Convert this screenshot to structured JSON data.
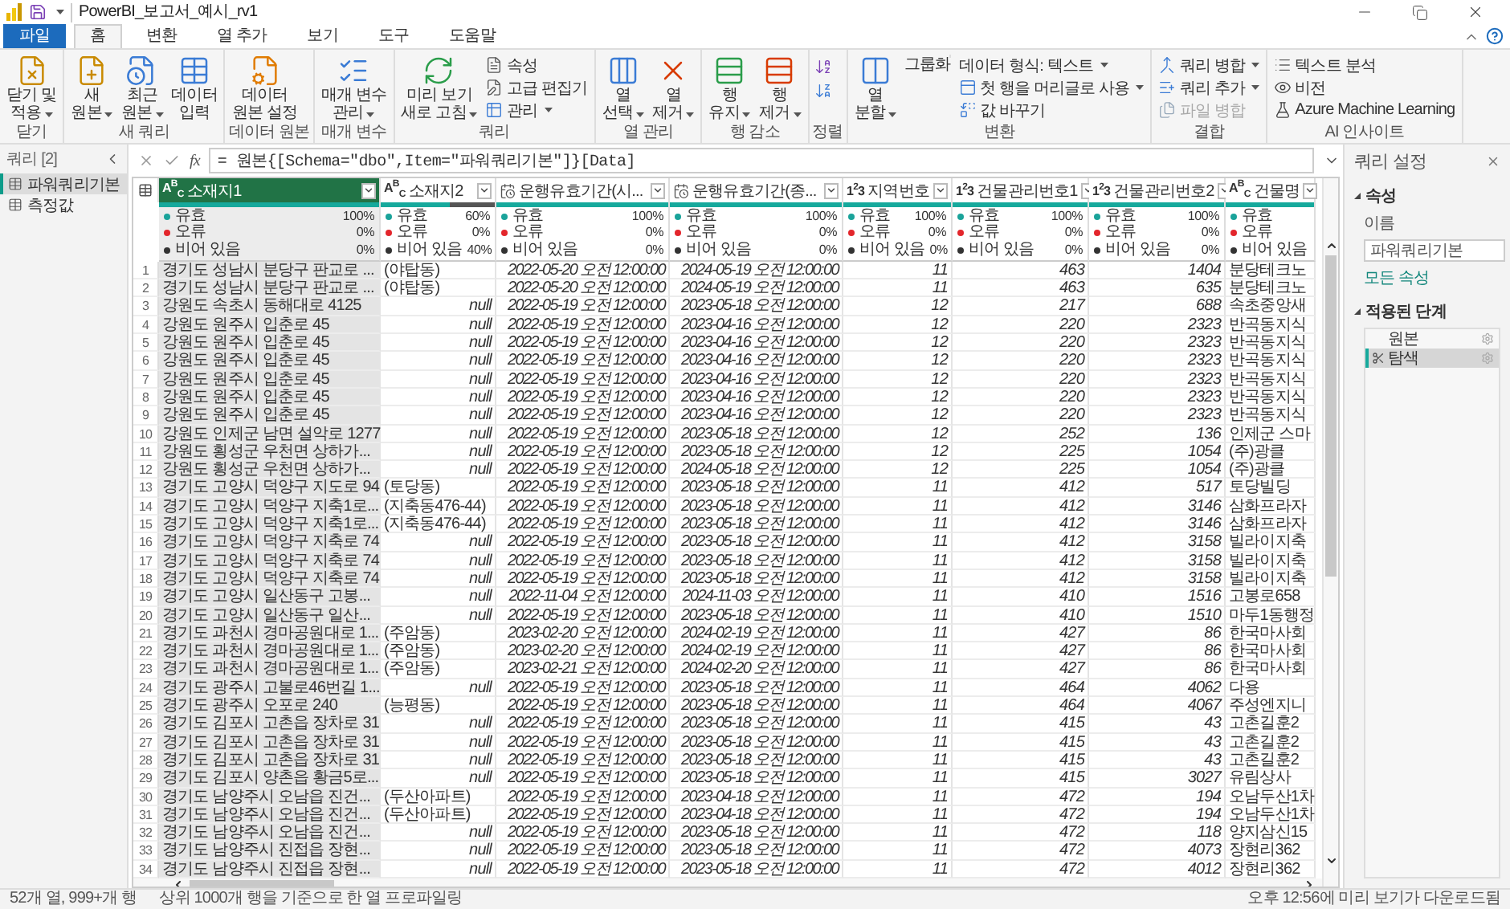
{
  "window": {
    "title": "PowerBI_보고서_예시_rv1"
  },
  "tabs": [
    {
      "label": "파일",
      "kind": "menu",
      "selected": false
    },
    {
      "label": "홈",
      "kind": "tab",
      "selected": true
    },
    {
      "label": "변환",
      "kind": "tab",
      "selected": false
    },
    {
      "label": "열 추가",
      "kind": "tab",
      "selected": false
    },
    {
      "label": "보기",
      "kind": "tab",
      "selected": false
    },
    {
      "label": "도구",
      "kind": "tab",
      "selected": false
    },
    {
      "label": "도움말",
      "kind": "tab",
      "selected": false
    }
  ],
  "ribbon": {
    "groups": [
      {
        "label": "닫기",
        "items": [
          {
            "kind": "large",
            "lines": [
              "닫기 및",
              "적용"
            ],
            "dropdown": true
          }
        ]
      },
      {
        "label": "새 쿼리",
        "items": [
          {
            "kind": "large",
            "lines": [
              "새",
              "원본"
            ],
            "dropdown": true
          },
          {
            "kind": "large",
            "lines": [
              "최근",
              "원본"
            ],
            "dropdown": true
          },
          {
            "kind": "large",
            "lines": [
              "데이터",
              "입력"
            ],
            "dropdown": false
          }
        ]
      },
      {
        "label": "데이터 원본",
        "items": [
          {
            "kind": "large",
            "lines": [
              "데이터",
              "원본 설정"
            ],
            "dropdown": false
          }
        ]
      },
      {
        "label": "매개 변수",
        "items": [
          {
            "kind": "large",
            "lines": [
              "매개 변수",
              "관리"
            ],
            "dropdown": true
          }
        ]
      },
      {
        "label": "쿼리",
        "items": [
          {
            "kind": "large",
            "lines": [
              "미리 보기",
              "새로 고침"
            ],
            "dropdown": true
          },
          {
            "kind": "stack",
            "items": [
              {
                "label": "속성",
                "dropdown": false,
                "disabled": false
              },
              {
                "label": "고급 편집기",
                "dropdown": false,
                "disabled": false
              },
              {
                "label": "관리",
                "dropdown": true,
                "disabled": false
              }
            ]
          }
        ]
      },
      {
        "label": "열 관리",
        "items": [
          {
            "kind": "large",
            "lines": [
              "열",
              "선택"
            ],
            "dropdown": true
          },
          {
            "kind": "large",
            "lines": [
              "열",
              "제거"
            ],
            "dropdown": true
          }
        ]
      },
      {
        "label": "행 감소",
        "items": [
          {
            "kind": "large",
            "lines": [
              "행",
              "유지"
            ],
            "dropdown": true
          },
          {
            "kind": "large",
            "lines": [
              "행",
              "제거"
            ],
            "dropdown": true
          }
        ]
      },
      {
        "label": "정렬",
        "items": [
          {
            "kind": "stack",
            "items": [
              {
                "disabled": false
              },
              {
                "disabled": false
              }
            ]
          }
        ]
      },
      {
        "label": "변환",
        "items": [
          {
            "kind": "large",
            "lines": [
              "열",
              "분할"
            ],
            "dropdown": true
          },
          {
            "kind": "large",
            "lines": [
              "그룹화"
            ],
            "dropdown": false
          },
          {
            "kind": "stack",
            "items": [
              {
                "label": "데이터 형식: 텍스트",
                "dropdown": true,
                "disabled": false
              },
              {
                "label": "첫 행을 머리글로 사용",
                "dropdown": true,
                "disabled": false
              },
              {
                "label": "값 바꾸기",
                "dropdown": false,
                "disabled": false
              }
            ]
          }
        ]
      },
      {
        "label": "결합",
        "items": [
          {
            "kind": "stack",
            "items": [
              {
                "label": "쿼리 병합",
                "dropdown": true,
                "disabled": false
              },
              {
                "label": "쿼리 추가",
                "dropdown": true,
                "disabled": false
              },
              {
                "label": "파일 병합",
                "dropdown": false,
                "disabled": true
              }
            ]
          }
        ]
      },
      {
        "label": "AI 인사이트",
        "items": [
          {
            "kind": "stack",
            "items": [
              {
                "label": "텍스트 분석",
                "dropdown": false,
                "disabled": false
              },
              {
                "label": "비전",
                "dropdown": false,
                "disabled": false
              },
              {
                "label": "Azure Machine Learning",
                "dropdown": false,
                "disabled": false
              }
            ]
          }
        ]
      }
    ]
  },
  "queries": {
    "title": "쿼리 [2]",
    "items": [
      {
        "label": "파워쿼리기본",
        "selected": true
      },
      {
        "label": "측정값",
        "selected": false
      }
    ]
  },
  "formula": {
    "fx_label": "fx",
    "text": "= 원본{[Schema=\"dbo\",Item=\"파워쿼리기본\"]}[Data]"
  },
  "table": {
    "columns": [
      {
        "kind": "text",
        "type_label": "A$^{B}$$_{C}$",
        "name": "소재지1",
        "selected": true,
        "level": 1,
        "stats": [
          {
            "label": "유효",
            "value": "100%",
            "color": "#1aa39a"
          },
          {
            "label": "오류",
            "value": "0%",
            "color": "#e3262c"
          },
          {
            "label": "비어 있음",
            "value": "0%",
            "color": "#333333"
          }
        ]
      },
      {
        "kind": "text",
        "type_label": "A$^{B}$$_{C}$",
        "name": "소재지2",
        "selected": false,
        "level": 0.6,
        "stats": [
          {
            "label": "유효",
            "value": "60%",
            "color": "#1aa39a"
          },
          {
            "label": "오류",
            "value": "0%",
            "color": "#e3262c"
          },
          {
            "label": "비어 있음",
            "value": "40%",
            "color": "#333333"
          }
        ]
      },
      {
        "kind": "datetime",
        "name": "운행유효기간(시...",
        "selected": false,
        "level": 1,
        "stats": [
          {
            "label": "유효",
            "value": "100%",
            "color": "#1aa39a"
          },
          {
            "label": "오류",
            "value": "0%",
            "color": "#e3262c"
          },
          {
            "label": "비어 있음",
            "value": "0%",
            "color": "#333333"
          }
        ]
      },
      {
        "kind": "datetime",
        "name": "운행유효기간(종...",
        "selected": false,
        "level": 1,
        "stats": [
          {
            "label": "유효",
            "value": "100%",
            "color": "#1aa39a"
          },
          {
            "label": "오류",
            "value": "0%",
            "color": "#e3262c"
          },
          {
            "label": "비어 있음",
            "value": "0%",
            "color": "#333333"
          }
        ]
      },
      {
        "kind": "number",
        "type_label": "1$^{2}$3",
        "name": "지역번호",
        "selected": false,
        "level": 1,
        "stats": [
          {
            "label": "유효",
            "value": "100%",
            "color": "#1aa39a"
          },
          {
            "label": "오류",
            "value": "0%",
            "color": "#e3262c"
          },
          {
            "label": "비어 있음",
            "value": "0%",
            "color": "#333333"
          }
        ]
      },
      {
        "kind": "number",
        "type_label": "1$^{2}$3",
        "name": "건물관리번호1",
        "selected": false,
        "level": 1,
        "stats": [
          {
            "label": "유효",
            "value": "100%",
            "color": "#1aa39a"
          },
          {
            "label": "오류",
            "value": "0%",
            "color": "#e3262c"
          },
          {
            "label": "비어 있음",
            "value": "0%",
            "color": "#333333"
          }
        ]
      },
      {
        "kind": "number",
        "type_label": "1$^{2}$3",
        "name": "건물관리번호2",
        "selected": false,
        "level": 1,
        "stats": [
          {
            "label": "유효",
            "value": "100%",
            "color": "#1aa39a"
          },
          {
            "label": "오류",
            "value": "0%",
            "color": "#e3262c"
          },
          {
            "label": "비어 있음",
            "value": "0%",
            "color": "#333333"
          }
        ]
      },
      {
        "kind": "text",
        "type_label": "A$^{B}$$_{C}$",
        "name": "건물명",
        "selected": false,
        "level": 1,
        "stats": [
          {
            "label": "유효",
            "color": "#1aa39a"
          },
          {
            "label": "오류",
            "color": "#e3262c"
          },
          {
            "label": "비어 있음",
            "color": "#333333"
          }
        ]
      }
    ],
    "rows": [
      {
        "number": "1",
        "location2_null": false,
        "cells": [
          "경기도 성남시 분당구 판교로 ...",
          "(야탑동)",
          "2022-05-20 오전 12:00:00",
          "2024-05-19 오전 12:00:00",
          "11",
          "463",
          "1404",
          "분당테크노"
        ]
      },
      {
        "number": "2",
        "location2_null": false,
        "cells": [
          "경기도 성남시 분당구 판교로 ...",
          "(야탑동)",
          "2022-05-20 오전 12:00:00",
          "2024-05-19 오전 12:00:00",
          "11",
          "463",
          "635",
          "분당테크노"
        ]
      },
      {
        "number": "3",
        "location2_null": true,
        "cells": [
          "강원도 속초시 동해대로 4125",
          "null",
          "2022-05-19 오전 12:00:00",
          "2023-05-18 오전 12:00:00",
          "12",
          "217",
          "688",
          "속초중앙새"
        ]
      },
      {
        "number": "4",
        "location2_null": true,
        "cells": [
          "강원도 원주시 입춘로 45",
          "null",
          "2022-05-19 오전 12:00:00",
          "2023-04-16 오전 12:00:00",
          "12",
          "220",
          "2323",
          "반곡동지식"
        ]
      },
      {
        "number": "5",
        "location2_null": true,
        "cells": [
          "강원도 원주시 입춘로 45",
          "null",
          "2022-05-19 오전 12:00:00",
          "2023-04-16 오전 12:00:00",
          "12",
          "220",
          "2323",
          "반곡동지식"
        ]
      },
      {
        "number": "6",
        "location2_null": true,
        "cells": [
          "강원도 원주시 입춘로 45",
          "null",
          "2022-05-19 오전 12:00:00",
          "2023-04-16 오전 12:00:00",
          "12",
          "220",
          "2323",
          "반곡동지식"
        ]
      },
      {
        "number": "7",
        "location2_null": true,
        "cells": [
          "강원도 원주시 입춘로 45",
          "null",
          "2022-05-19 오전 12:00:00",
          "2023-04-16 오전 12:00:00",
          "12",
          "220",
          "2323",
          "반곡동지식"
        ]
      },
      {
        "number": "8",
        "location2_null": true,
        "cells": [
          "강원도 원주시 입춘로 45",
          "null",
          "2022-05-19 오전 12:00:00",
          "2023-04-16 오전 12:00:00",
          "12",
          "220",
          "2323",
          "반곡동지식"
        ]
      },
      {
        "number": "9",
        "location2_null": true,
        "cells": [
          "강원도 원주시 입춘로 45",
          "null",
          "2022-05-19 오전 12:00:00",
          "2023-04-16 오전 12:00:00",
          "12",
          "220",
          "2323",
          "반곡동지식"
        ]
      },
      {
        "number": "10",
        "location2_null": true,
        "cells": [
          "강원도 인제군 남면 설악로 1277",
          "null",
          "2022-05-19 오전 12:00:00",
          "2023-05-18 오전 12:00:00",
          "12",
          "252",
          "136",
          "인제군 스마"
        ]
      },
      {
        "number": "11",
        "location2_null": true,
        "cells": [
          "강원도 횡성군 우천면 상하가...",
          "null",
          "2022-05-19 오전 12:00:00",
          "2023-05-18 오전 12:00:00",
          "12",
          "225",
          "1054",
          "(주)광클"
        ]
      },
      {
        "number": "12",
        "location2_null": true,
        "cells": [
          "강원도 횡성군 우천면 상하가...",
          "null",
          "2022-05-19 오전 12:00:00",
          "2024-05-18 오전 12:00:00",
          "12",
          "225",
          "1054",
          "(주)광클"
        ]
      },
      {
        "number": "13",
        "location2_null": false,
        "cells": [
          "경기도 고양시 덕양구 지도로 94",
          "(토당동)",
          "2022-05-19 오전 12:00:00",
          "2023-05-18 오전 12:00:00",
          "11",
          "412",
          "517",
          "토당빌딩"
        ]
      },
      {
        "number": "14",
        "location2_null": false,
        "cells": [
          "경기도 고양시 덕양구 지축1로...",
          "(지축동476-44)",
          "2022-05-19 오전 12:00:00",
          "2023-05-18 오전 12:00:00",
          "11",
          "412",
          "3146",
          "삼화프라자"
        ]
      },
      {
        "number": "15",
        "location2_null": false,
        "cells": [
          "경기도 고양시 덕양구 지축1로...",
          "(지축동476-44)",
          "2022-05-19 오전 12:00:00",
          "2023-05-18 오전 12:00:00",
          "11",
          "412",
          "3146",
          "삼화프라자"
        ]
      },
      {
        "number": "16",
        "location2_null": true,
        "cells": [
          "경기도 고양시 덕양구 지축로 74",
          "null",
          "2022-05-19 오전 12:00:00",
          "2023-05-18 오전 12:00:00",
          "11",
          "412",
          "3158",
          "빌라이지축"
        ]
      },
      {
        "number": "17",
        "location2_null": true,
        "cells": [
          "경기도 고양시 덕양구 지축로 74",
          "null",
          "2022-05-19 오전 12:00:00",
          "2023-05-18 오전 12:00:00",
          "11",
          "412",
          "3158",
          "빌라이지축"
        ]
      },
      {
        "number": "18",
        "location2_null": true,
        "cells": [
          "경기도 고양시 덕양구 지축로 74",
          "null",
          "2022-05-19 오전 12:00:00",
          "2023-05-18 오전 12:00:00",
          "11",
          "412",
          "3158",
          "빌라이지축"
        ]
      },
      {
        "number": "19",
        "location2_null": true,
        "cells": [
          "경기도 고양시 일산동구 고봉...",
          "null",
          "2022-11-04 오전 12:00:00",
          "2024-11-03 오전 12:00:00",
          "11",
          "410",
          "1516",
          "고봉로658"
        ]
      },
      {
        "number": "20",
        "location2_null": true,
        "cells": [
          "경기도 고양시 일산동구 일산...",
          "null",
          "2022-05-19 오전 12:00:00",
          "2023-05-18 오전 12:00:00",
          "11",
          "410",
          "1510",
          "마두1동행정"
        ]
      },
      {
        "number": "21",
        "location2_null": false,
        "cells": [
          "경기도 과천시 경마공원대로 1...",
          "(주암동)",
          "2023-02-20 오전 12:00:00",
          "2024-02-19 오전 12:00:00",
          "11",
          "427",
          "86",
          "한국마사회"
        ]
      },
      {
        "number": "22",
        "location2_null": false,
        "cells": [
          "경기도 과천시 경마공원대로 1...",
          "(주암동)",
          "2023-02-20 오전 12:00:00",
          "2024-02-19 오전 12:00:00",
          "11",
          "427",
          "86",
          "한국마사회"
        ]
      },
      {
        "number": "23",
        "location2_null": false,
        "cells": [
          "경기도 과천시 경마공원대로 1...",
          "(주암동)",
          "2023-02-21 오전 12:00:00",
          "2024-02-20 오전 12:00:00",
          "11",
          "427",
          "86",
          "한국마사회"
        ]
      },
      {
        "number": "24",
        "location2_null": true,
        "cells": [
          "경기도 광주시 고불로46번길 1...",
          "null",
          "2022-05-19 오전 12:00:00",
          "2023-05-18 오전 12:00:00",
          "11",
          "464",
          "4062",
          "다용"
        ]
      },
      {
        "number": "25",
        "location2_null": false,
        "cells": [
          "경기도 광주시 오포로 240",
          "(능평동)",
          "2022-05-19 오전 12:00:00",
          "2023-05-18 오전 12:00:00",
          "11",
          "464",
          "4067",
          "주성엔지니"
        ]
      },
      {
        "number": "26",
        "location2_null": true,
        "cells": [
          "경기도 김포시 고촌읍 장차로 31",
          "null",
          "2022-05-19 오전 12:00:00",
          "2023-05-18 오전 12:00:00",
          "11",
          "415",
          "43",
          "고촌길훈2"
        ]
      },
      {
        "number": "27",
        "location2_null": true,
        "cells": [
          "경기도 김포시 고촌읍 장차로 31",
          "null",
          "2022-05-19 오전 12:00:00",
          "2023-05-18 오전 12:00:00",
          "11",
          "415",
          "43",
          "고촌길훈2"
        ]
      },
      {
        "number": "28",
        "location2_null": true,
        "cells": [
          "경기도 김포시 고촌읍 장차로 31",
          "null",
          "2022-05-19 오전 12:00:00",
          "2023-05-18 오전 12:00:00",
          "11",
          "415",
          "43",
          "고촌길훈2"
        ]
      },
      {
        "number": "29",
        "location2_null": true,
        "cells": [
          "경기도 김포시 양촌읍 황금5로...",
          "null",
          "2022-05-19 오전 12:00:00",
          "2023-05-18 오전 12:00:00",
          "11",
          "415",
          "3027",
          "유림상사"
        ]
      },
      {
        "number": "30",
        "location2_null": false,
        "cells": [
          "경기도 남양주시 오남읍 진건...",
          "(두산아파트)",
          "2022-05-19 오전 12:00:00",
          "2023-04-18 오전 12:00:00",
          "11",
          "472",
          "194",
          "오남두산1차"
        ]
      },
      {
        "number": "31",
        "location2_null": false,
        "cells": [
          "경기도 남양주시 오남읍 진건...",
          "(두산아파트)",
          "2022-05-19 오전 12:00:00",
          "2023-04-18 오전 12:00:00",
          "11",
          "472",
          "194",
          "오남두산1차"
        ]
      },
      {
        "number": "32",
        "location2_null": true,
        "cells": [
          "경기도 남양주시 오남읍 진건...",
          "null",
          "2022-05-19 오전 12:00:00",
          "2023-05-18 오전 12:00:00",
          "11",
          "472",
          "118",
          "양지삼신15"
        ]
      },
      {
        "number": "33",
        "location2_null": true,
        "cells": [
          "경기도 남양주시 진접읍 장현...",
          "null",
          "2022-05-19 오전 12:00:00",
          "2023-05-18 오전 12:00:00",
          "11",
          "472",
          "4073",
          "장현리362"
        ]
      },
      {
        "number": "34",
        "location2_null": true,
        "cells": [
          "경기도 남양주시 진접읍 장현...",
          "null",
          "2022-05-19 오전 12:00:00",
          "2023-05-18 오전 12:00:00",
          "11",
          "472",
          "4012",
          "장현리362"
        ]
      }
    ]
  },
  "settings": {
    "title": "쿼리 설정",
    "properties_heading": "속성",
    "name_label": "이름",
    "name_value": "파워쿼리기본",
    "all_properties_link": "모든 속성",
    "steps_heading": "적용된 단계",
    "steps": [
      {
        "label": "원본",
        "kind": "source",
        "selected": false
      },
      {
        "label": "탐색",
        "kind": "navigation",
        "selected": true
      }
    ]
  },
  "status_bar": {
    "left": [
      "52개 열, 999+개 행",
      "상위 1000개 행을 기준으로 한 열 프로파일링"
    ],
    "right": "오후 12:56에 미리 보기가 다운로드됨"
  }
}
